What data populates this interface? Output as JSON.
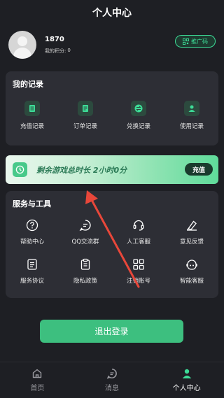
{
  "header": {
    "title": "个人中心"
  },
  "profile": {
    "phone": "1870",
    "points_label": "我的积分:",
    "points_value": "0",
    "promo_label": "推广码"
  },
  "records": {
    "title": "我的记录",
    "items": [
      {
        "label": "充值记录",
        "icon": "document-icon"
      },
      {
        "label": "订单记录",
        "icon": "list-icon"
      },
      {
        "label": "兑换记录",
        "icon": "exchange-icon"
      },
      {
        "label": "使用记录",
        "icon": "user-icon"
      }
    ]
  },
  "banner": {
    "text": "剩余游戏总时长 2小时0分",
    "button": "充值"
  },
  "services": {
    "title": "服务与工具",
    "items": [
      {
        "label": "帮助中心",
        "icon": "help-icon"
      },
      {
        "label": "QQ交流群",
        "icon": "chat-icon"
      },
      {
        "label": "人工客服",
        "icon": "headset-icon"
      },
      {
        "label": "意见反馈",
        "icon": "feedback-icon"
      },
      {
        "label": "服务协议",
        "icon": "agreement-icon"
      },
      {
        "label": "隐私政策",
        "icon": "clipboard-icon"
      },
      {
        "label": "注销账号",
        "icon": "grid-icon"
      },
      {
        "label": "智能客服",
        "icon": "robot-icon"
      }
    ]
  },
  "logout": {
    "label": "退出登录"
  },
  "tabbar": {
    "items": [
      {
        "label": "首页",
        "icon": "home-icon"
      },
      {
        "label": "消息",
        "icon": "message-icon"
      },
      {
        "label": "个人中心",
        "icon": "person-icon"
      }
    ]
  },
  "colors": {
    "accent": "#3ddc97",
    "button": "#3dbf7f",
    "background": "#1e1f24",
    "card": "#2d2e35",
    "annotation_arrow": "#e8473a"
  }
}
